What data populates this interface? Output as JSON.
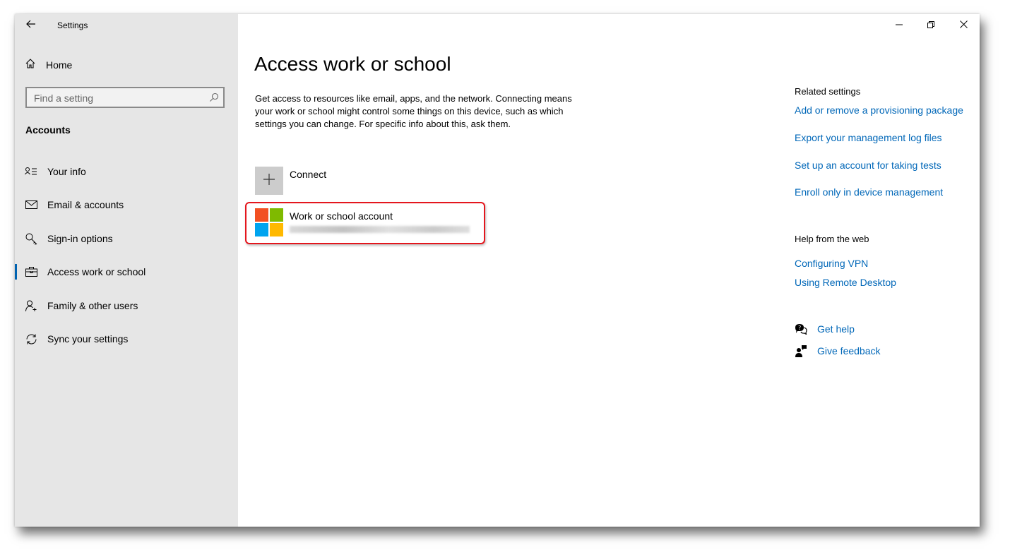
{
  "window": {
    "title": "Settings"
  },
  "sidebar": {
    "home_label": "Home",
    "search": {
      "placeholder": "Find a setting"
    },
    "section_label": "Accounts",
    "items": [
      {
        "label": "Your info",
        "icon": "contact-info-icon",
        "active": false
      },
      {
        "label": "Email & accounts",
        "icon": "mail-icon",
        "active": false
      },
      {
        "label": "Sign-in options",
        "icon": "key-icon",
        "active": false
      },
      {
        "label": "Access work or school",
        "icon": "briefcase-icon",
        "active": true
      },
      {
        "label": "Family & other users",
        "icon": "add-person-icon",
        "active": false
      },
      {
        "label": "Sync your settings",
        "icon": "sync-icon",
        "active": false
      }
    ]
  },
  "main": {
    "title": "Access work or school",
    "description": "Get access to resources like email, apps, and the network. Connecting means your work or school might control some things on this device, such as which settings you can change. For specific info about this, ask them.",
    "connect_label": "Connect",
    "account": {
      "name": "Work or school account"
    }
  },
  "related": {
    "heading": "Related settings",
    "links": [
      "Add or remove a provisioning package",
      "Export your management log files",
      "Set up an account for taking tests",
      "Enroll only in device management"
    ],
    "help_heading": "Help from the web",
    "help_links": [
      "Configuring VPN",
      "Using Remote Desktop"
    ],
    "get_help": "Get help",
    "give_feedback": "Give feedback"
  },
  "colors": {
    "accent": "#0063b1",
    "link": "#0067b8",
    "highlight": "#e4161d",
    "sidebar_bg": "#e6e6e6",
    "ms_red": "#f25022",
    "ms_green": "#7fba00",
    "ms_blue": "#00a4ef",
    "ms_yellow": "#ffb900"
  }
}
